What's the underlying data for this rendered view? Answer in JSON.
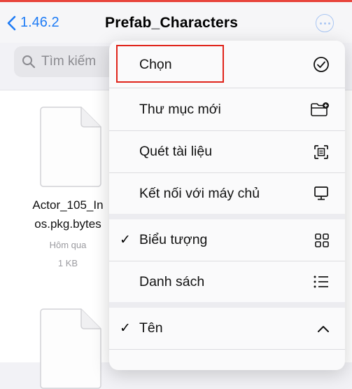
{
  "navbar": {
    "back_label": "1.46.2",
    "title": "Prefab_Characters"
  },
  "search": {
    "placeholder": "Tìm kiếm"
  },
  "files": [
    {
      "name_line1": "Actor_105_In",
      "name_line2": "os.pkg.bytes",
      "date": "Hôm qua",
      "size": "1 KB"
    }
  ],
  "menu": {
    "select": "Chọn",
    "new_folder": "Thư mục mới",
    "scan": "Quét tài liệu",
    "connect": "Kết nối với máy chủ",
    "icons": "Biểu tượng",
    "list": "Danh sách",
    "name": "Tên",
    "check_glyph": "✓"
  },
  "colors": {
    "accent": "#1f7cf5",
    "highlight": "#e0241b"
  }
}
